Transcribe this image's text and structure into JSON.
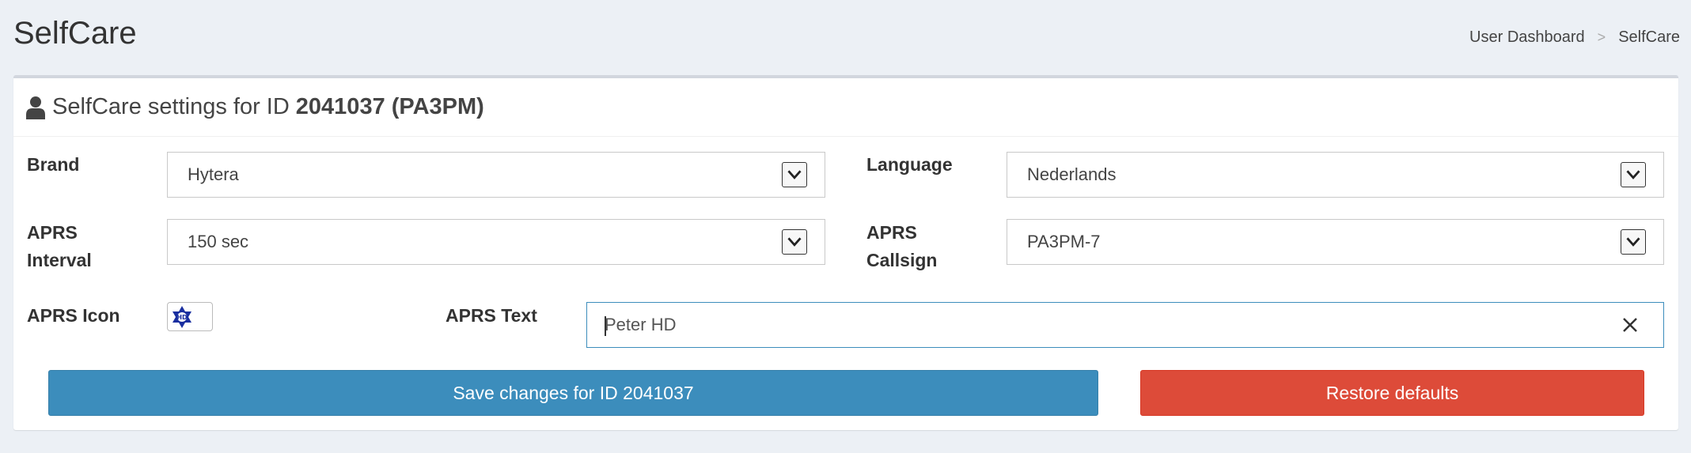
{
  "header": {
    "title": "SelfCare",
    "breadcrumb": [
      "User Dashboard",
      "SelfCare"
    ],
    "breadcrumb_separator": ">"
  },
  "box": {
    "title_prefix": "SelfCare settings for ID",
    "title_id": "2041037 (PA3PM)",
    "header_icon": "user-icon"
  },
  "form": {
    "brand": {
      "label": "Brand",
      "value": "Hytera"
    },
    "language": {
      "label": "Language",
      "value": "Nederlands"
    },
    "aprs_interval": {
      "label_line1": "APRS",
      "label_line2": "Interval",
      "value": "150 sec"
    },
    "aprs_callsign": {
      "label_line1": "APRS",
      "label_line2": "Callsign",
      "value": "PA3PM-7"
    },
    "aprs_icon": {
      "label": "APRS Icon",
      "icon": "star-of-david-icon"
    },
    "aprs_text": {
      "label": "APRS Text",
      "value": "Peter HD"
    }
  },
  "buttons": {
    "save": "Save changes for ID 2041037",
    "restore": "Restore defaults"
  },
  "colors": {
    "primary": "#3c8dbc",
    "danger": "#dd4b39",
    "background": "#ecf0f5"
  }
}
